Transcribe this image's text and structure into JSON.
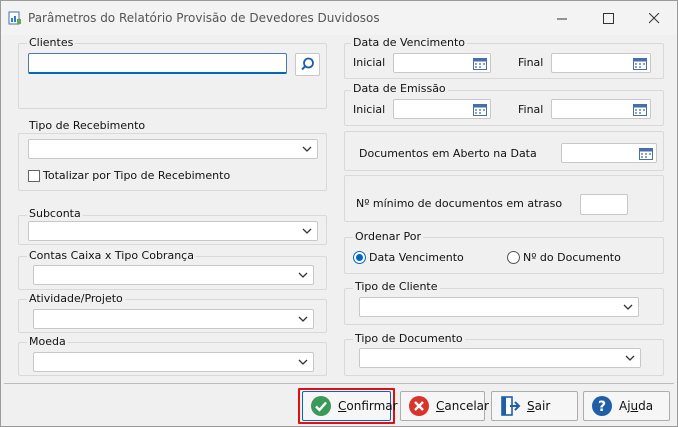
{
  "window": {
    "title": "Parâmetros do Relatório Provisão de Devedores Duvidosos"
  },
  "left": {
    "clientes_label": "Clientes",
    "clientes_value": "",
    "tipo_recebimento_label": "Tipo de Recebimento",
    "totalizar_label": "Totalizar por Tipo de Recebimento",
    "subconta_label": "Subconta",
    "contas_caixa_label": "Contas Caixa x Tipo Cobrança",
    "atividade_label": "Atividade/Projeto",
    "moeda_label": "Moeda"
  },
  "right": {
    "vencimento_label": "Data de Vencimento",
    "emissao_label": "Data de Emissão",
    "inicial_label": "Inicial",
    "final_label": "Final",
    "docs_aberto_label": "Documentos em Aberto na Data",
    "min_docs_label": "Nº mínimo de documentos em atraso",
    "min_docs_value": "",
    "ordenar_label": "Ordenar Por",
    "ordenar_options": [
      "Data Vencimento",
      "Nº do Documento"
    ],
    "ordenar_selected": "Data Vencimento",
    "tipo_cliente_label": "Tipo de Cliente",
    "tipo_documento_label": "Tipo de Documento"
  },
  "buttons": {
    "confirmar": {
      "pre": "",
      "key": "C",
      "post": "onfirmar"
    },
    "cancelar": {
      "pre": "",
      "key": "C",
      "post": "ancelar"
    },
    "sair": {
      "pre": "",
      "key": "S",
      "post": "air"
    },
    "ajuda": {
      "pre": "Aj",
      "key": "u",
      "post": "da"
    }
  },
  "colors": {
    "accent": "#0067c0",
    "highlight": "#e01010",
    "confirm_icon": "#3a9a5a",
    "cancel_icon": "#d9342b",
    "help_icon": "#1f5fa8"
  }
}
